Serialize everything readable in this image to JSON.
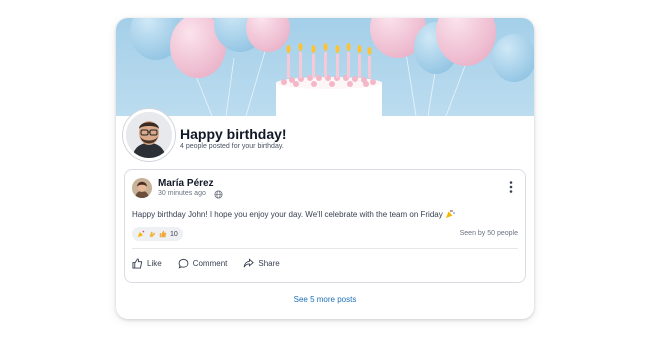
{
  "profile": {
    "title": "Happy birthday!",
    "subtitle": "4 people posted for your birthday."
  },
  "post": {
    "author": "María Pérez",
    "time": "30 minutes ago",
    "text": "Happy birthday John! I hope you enjoy your day. We'll celebrate with the team on Friday",
    "reactions": {
      "icons": [
        "party-icon",
        "clap-icon",
        "thumbs-up-icon"
      ],
      "count": "10"
    },
    "seen": "Seen by 50 people",
    "actions": {
      "like": "Like",
      "comment": "Comment",
      "share": "Share"
    }
  },
  "see_more": "See 5 more posts",
  "colors": {
    "link": "#1d6fb8",
    "banner_bg": "#a8d2eb",
    "balloon_pink": "#f2c1d4",
    "balloon_blue": "#9ccbe6"
  }
}
